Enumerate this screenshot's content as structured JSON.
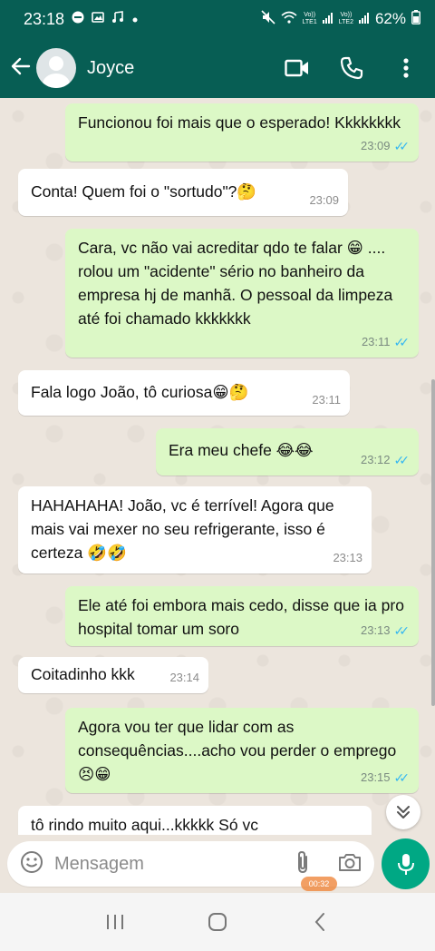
{
  "status_bar": {
    "time": "23:18",
    "network_1": "Vo))\nLTE1",
    "network_2": "Vo))\nLTE2",
    "battery": "62%"
  },
  "header": {
    "contact_name": "Joyce",
    "icons": [
      "back-arrow-icon",
      "avatar",
      "video-call-icon",
      "phone-icon",
      "more-vert-icon"
    ]
  },
  "messages": [
    {
      "dir": "out",
      "text": "Funcionou foi mais que o esperado! Kkkkkkkk",
      "time": "23:09",
      "read": true
    },
    {
      "dir": "in",
      "text": "Conta! Quem foi o \"sortudo\"?🤔",
      "time": "23:09"
    },
    {
      "dir": "out",
      "text": "Cara, vc não vai acreditar qdo te falar 😁 .... rolou um \"acidente\" sério no banheiro da empresa hj de manhã. O pessoal da limpeza até foi chamado kkkkkkk",
      "time": "23:11",
      "read": true
    },
    {
      "dir": "in",
      "text": "Fala logo João, tô curiosa😁🤔",
      "time": "23:11"
    },
    {
      "dir": "out",
      "text": "Era meu chefe 😂😂",
      "time": "23:12",
      "read": true
    },
    {
      "dir": "in",
      "text": "HAHAHAHA! João, vc é terrível! Agora que mais vai mexer no seu refrigerante, isso é certeza 🤣🤣",
      "time": "23:13"
    },
    {
      "dir": "out",
      "text": "Ele até foi embora mais cedo, disse que ia pro hospital tomar um soro",
      "time": "23:13",
      "read": true
    },
    {
      "dir": "in",
      "text": "Coitadinho kkk",
      "time": "23:14"
    },
    {
      "dir": "out",
      "text": "Agora vou ter que lidar com as consequências....acho  vou perder o emprego 😣😁",
      "time": "23:15",
      "read": true
    },
    {
      "dir": "in",
      "text": "tô rindo muito aqui...kkkkk Só vc",
      "time": ""
    }
  ],
  "input": {
    "placeholder": "Mensagem"
  },
  "recording_badge": "00:32",
  "colors": {
    "header": "#075e54",
    "outgoing_bubble": "#dcf8c6",
    "incoming_bubble": "#ffffff",
    "read_ticks": "#34b7f1",
    "mic_button": "#00a884"
  }
}
